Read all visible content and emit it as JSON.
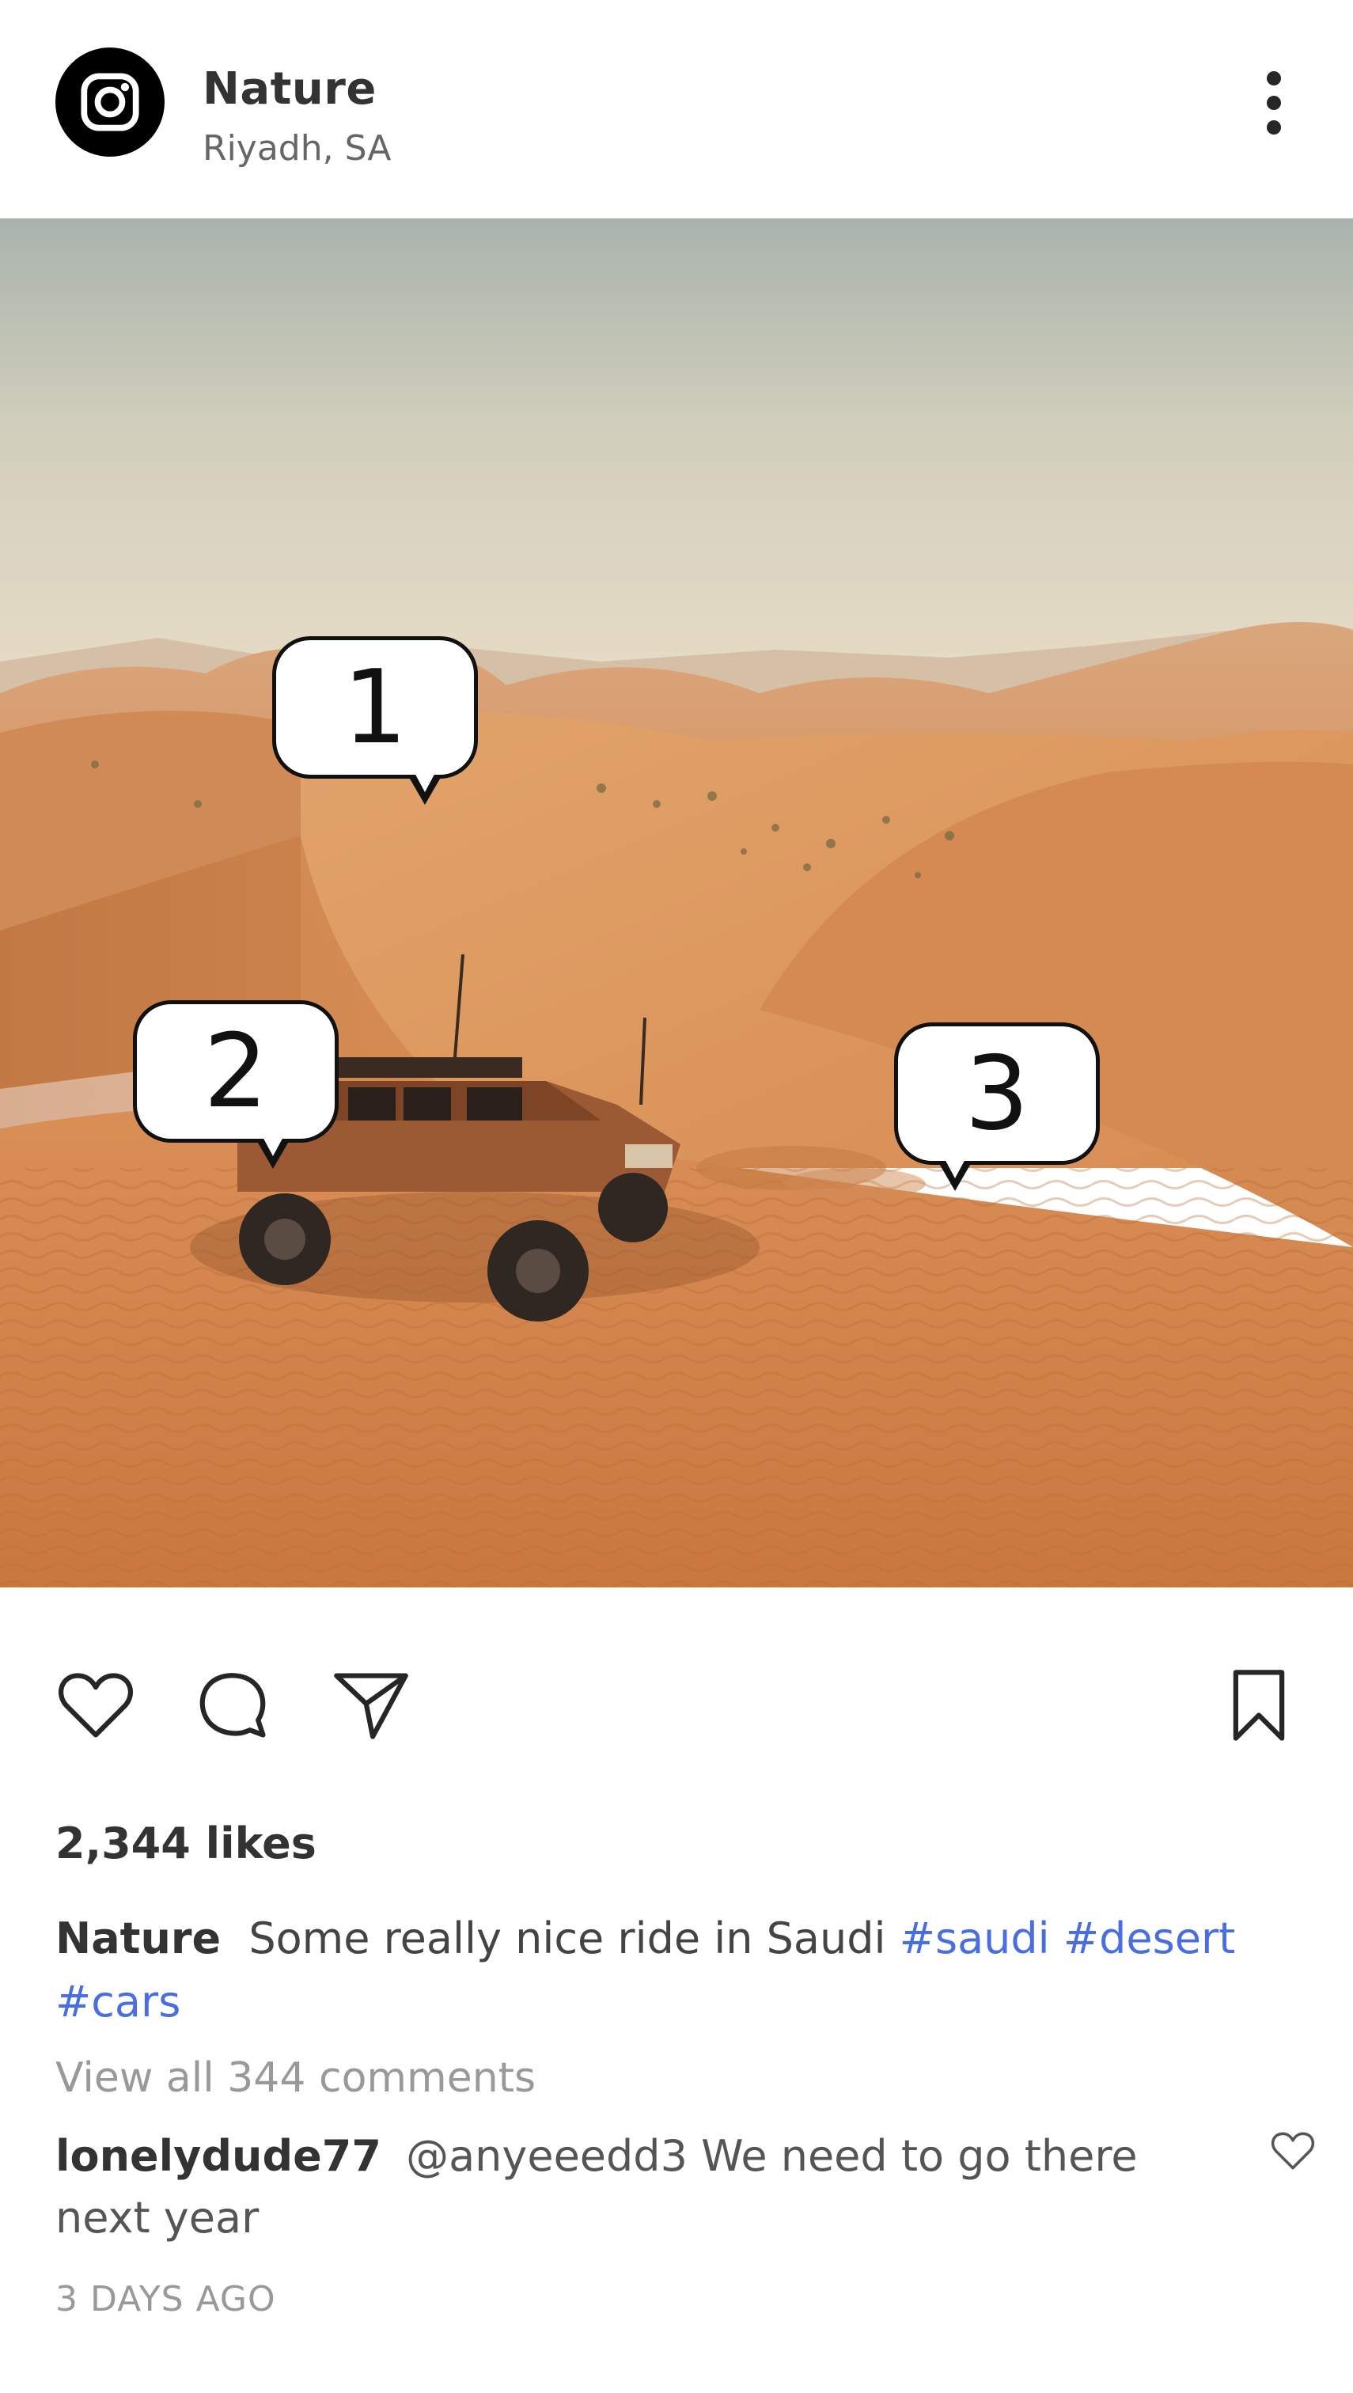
{
  "header": {
    "account_name": "Nature",
    "location": "Riyadh, SA",
    "avatar_icon": "instagram-logo-icon",
    "more_icon": "more-vertical-icon"
  },
  "photo": {
    "markers": [
      "1",
      "2",
      "3"
    ]
  },
  "actions": {
    "like_icon": "heart-icon",
    "comment_icon": "comment-icon",
    "share_icon": "send-icon",
    "save_icon": "bookmark-icon"
  },
  "post": {
    "likes": "2,344 likes",
    "caption_user": "Nature",
    "caption_text": "Some really nice ride in Saudi",
    "hashtags": [
      "#saudi",
      "#desert",
      "#cars"
    ],
    "view_comments": "View all 344 comments",
    "comment_user": "lonelydude77",
    "comment_text": "@anyeeedd3 We need to go there next year",
    "timestamp": "3 DAYS AGO"
  },
  "colors": {
    "hashtag": "#4a6ee0",
    "sand": "#d98d4e",
    "sky": "#dcd7c4"
  }
}
